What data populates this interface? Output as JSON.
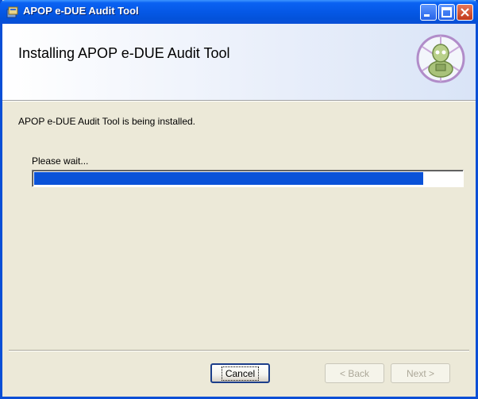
{
  "window": {
    "title": "APOP e-DUE Audit Tool",
    "colors": {
      "titlebar": "#0558e6",
      "progress": "#0a52d8",
      "face": "#ece9d8"
    }
  },
  "banner": {
    "title": "Installing APOP e-DUE Audit Tool",
    "logo_icon": "installer-robot-icon"
  },
  "body": {
    "status": "APOP e-DUE Audit Tool is being installed.",
    "wait_label": "Please wait...",
    "progress_percent": 91
  },
  "buttons": {
    "cancel": "Cancel",
    "back": "< Back",
    "next": "Next >"
  }
}
